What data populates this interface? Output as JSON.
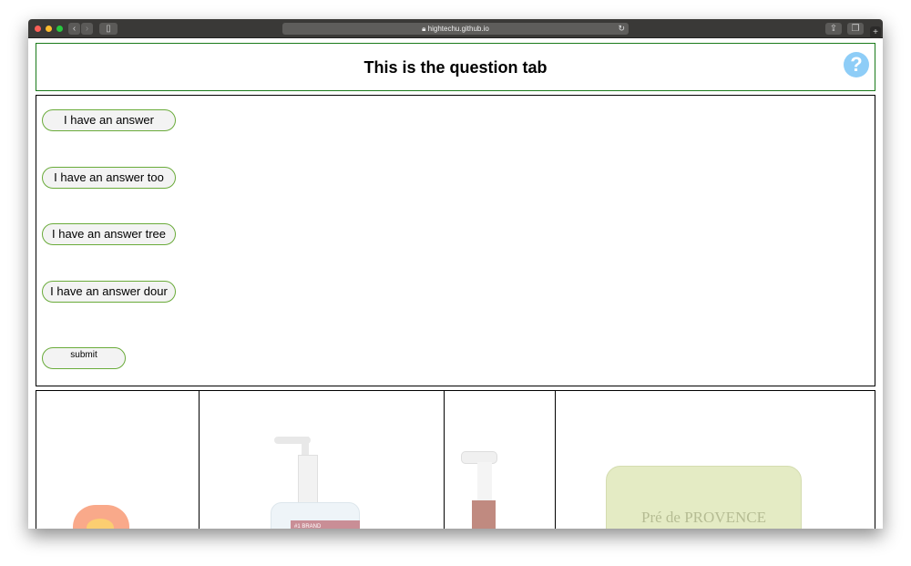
{
  "browser": {
    "url": "hightechu.github.io",
    "icons": [
      "close-dot",
      "minimize-dot",
      "zoom-dot",
      "back-icon",
      "forward-icon",
      "sidebar-icon",
      "lock-icon",
      "reload-icon",
      "share-icon",
      "tabs-icon",
      "new-tab-icon"
    ]
  },
  "header": {
    "title": "This is the question tab",
    "help_icon": "?"
  },
  "answers": [
    {
      "label": "I have an answer"
    },
    {
      "label": "I have an answer too"
    },
    {
      "label": "I have an answer tree"
    },
    {
      "label": "I have an answer dour"
    }
  ],
  "submit_label": "submit",
  "images": [
    {
      "name": "detergent-pods-image"
    },
    {
      "name": "hand-sanitizer-image",
      "label_text": "#1 BRAND"
    },
    {
      "name": "spray-bottle-image"
    },
    {
      "name": "soap-bar-image",
      "engraving": "Pré de PROVENCE"
    }
  ],
  "colors": {
    "button_border": "#6aab3a",
    "header_border": "#1a7a1a",
    "help": "#8ecdf7"
  }
}
